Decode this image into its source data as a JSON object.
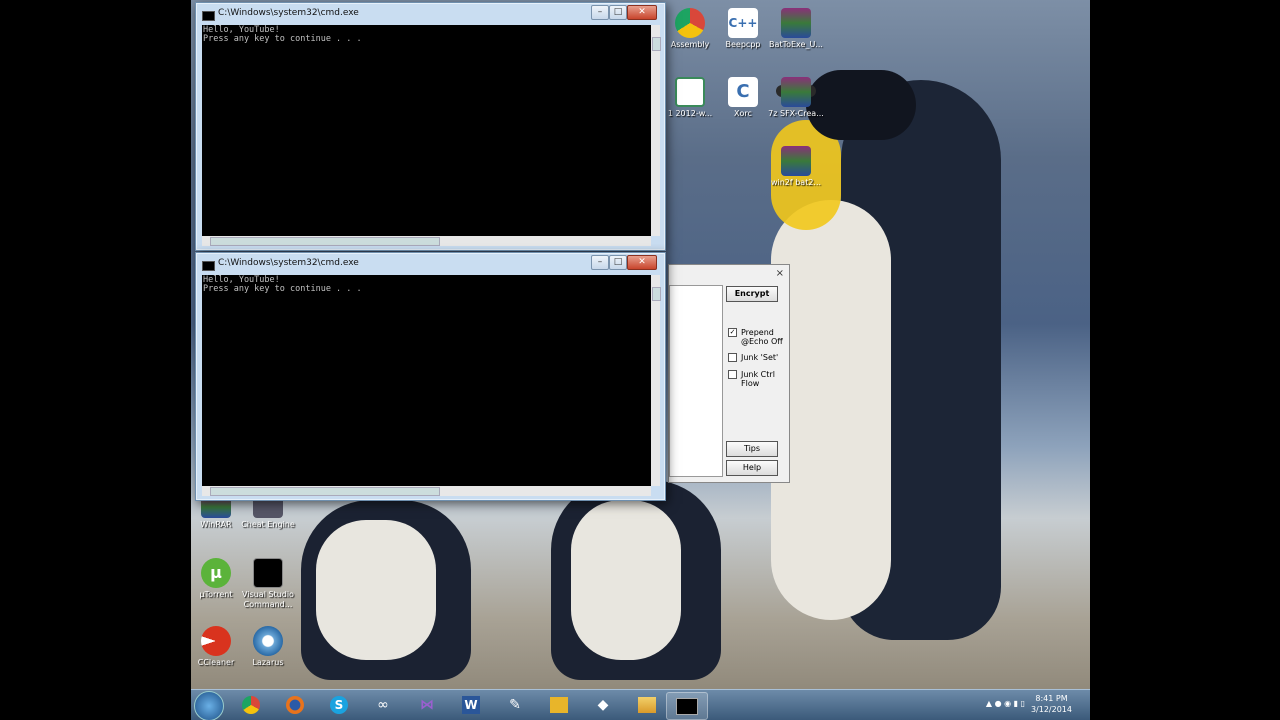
{
  "desktop_icons_right": [
    {
      "label": "Assembly",
      "name": "desktop-icon-chrome-assembly",
      "color": "#d9473a"
    },
    {
      "label": "Beepcpp",
      "name": "desktop-icon-cpp",
      "color": "#ffffff"
    },
    {
      "label": "BatToExe_U...",
      "name": "desktop-icon-winrar-battoexe",
      "color": "#8b2f7a"
    },
    {
      "label": "1 2012-w...",
      "name": "desktop-icon-doc",
      "color": "#ffffff"
    },
    {
      "label": "Xorc",
      "name": "desktop-icon-c",
      "color": "#ffffff"
    },
    {
      "label": "7z SFX-Crea...",
      "name": "desktop-icon-winrar-7z",
      "color": "#8b2f7a"
    },
    {
      "label": "win2f bat2...",
      "name": "desktop-icon-winrar-bat2",
      "color": "#8b2f7a"
    }
  ],
  "desktop_icons_left": [
    {
      "label": "WinRAR",
      "name": "desktop-icon-winrar"
    },
    {
      "label": "Cheat Engine",
      "name": "desktop-icon-cheat-engine"
    },
    {
      "label": "µTorrent",
      "name": "desktop-icon-utorrent"
    },
    {
      "label": "Visual Studio Command...",
      "name": "desktop-icon-vs-command"
    },
    {
      "label": "CCleaner",
      "name": "desktop-icon-ccleaner"
    },
    {
      "label": "Lazarus",
      "name": "desktop-icon-lazarus"
    }
  ],
  "cmd_window_1": {
    "title": "C:\\Windows\\system32\\cmd.exe",
    "output": "Hello, YouTube!\nPress any key to continue . . ."
  },
  "cmd_window_2": {
    "title": "C:\\Windows\\system32\\cmd.exe",
    "output": "Hello, YouTube!\nPress any key to continue . . ."
  },
  "encrypt_dialog": {
    "close_label": "×",
    "encrypt_button": "Encrypt",
    "options": [
      {
        "label": "Prepend @Echo Off",
        "checked": true
      },
      {
        "label": "Junk 'Set'",
        "checked": false
      },
      {
        "label": "Junk Ctrl Flow",
        "checked": false
      }
    ],
    "tips_button": "Tips",
    "help_button": "Help"
  },
  "taskbar": {
    "apps": [
      "Chrome",
      "Firefox",
      "Skype",
      "Game Controller",
      "Visual Studio",
      "Word",
      "Notepad++",
      "File Manager",
      "Cheat Engine",
      "Explorer",
      "Command Prompt"
    ],
    "clock_time": "8:41 PM",
    "clock_date": "3/12/2014"
  },
  "colors": {
    "accent": "#3b5a7a",
    "close_red": "#c8442c"
  }
}
